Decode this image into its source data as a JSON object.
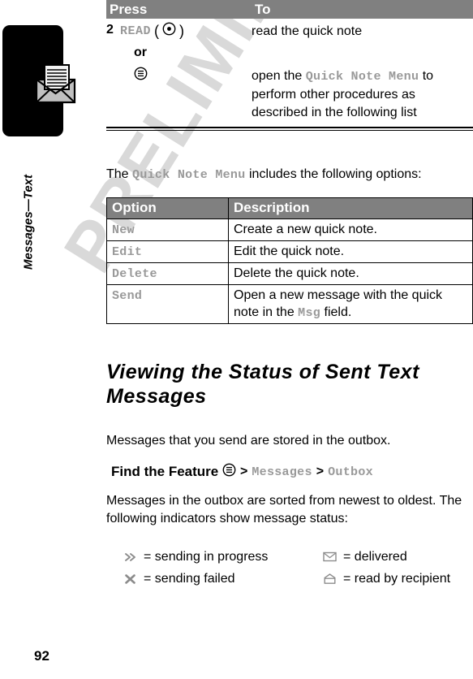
{
  "page": {
    "number": "92",
    "chapter_title": "Messages—Text",
    "watermark": "PRELIMINARY",
    "chapter_icon": "envelope-with-letter-icon"
  },
  "steps_table": {
    "headers": {
      "press": "Press",
      "to": "To"
    },
    "rows": [
      {
        "number": "2",
        "key_label": "READ",
        "key_icon": "center-select-key-icon",
        "description": "read the quick note"
      }
    ],
    "or_label": "or",
    "alt_row": {
      "key_icon": "menu-key-icon",
      "description_before": "open the ",
      "description_mono": "Quick Note Menu",
      "description_after": " to perform other procedures as described in the following list"
    }
  },
  "intro": {
    "before": "The ",
    "mono": "Quick Note Menu",
    "after": " includes the following options:"
  },
  "options_table": {
    "headers": {
      "option": "Option",
      "description": "Description"
    },
    "rows": [
      {
        "option": "New",
        "description": "Create a new quick note."
      },
      {
        "option": "Edit",
        "description": "Edit the quick note."
      },
      {
        "option": "Delete",
        "description": "Delete the quick note."
      },
      {
        "option": "Send",
        "description_before": "Open a new message with the quick note in the ",
        "description_mono": "Msg",
        "description_after": " field."
      }
    ]
  },
  "section": {
    "heading": "Viewing the Status of Sent Text Messages",
    "outbox_para": "Messages that you send are stored in the outbox.",
    "sorted_para": "Messages in the outbox are sorted from newest to oldest. The following indicators show message status:"
  },
  "find_feature": {
    "label": "Find the Feature",
    "menu_icon": "menu-key-icon",
    "separator": ">",
    "path": [
      "Messages",
      "Outbox"
    ]
  },
  "indicators": [
    {
      "icon": "double-chevron-icon",
      "glyph": "»",
      "label": "= sending in progress"
    },
    {
      "icon": "closed-envelope-icon",
      "glyph": "",
      "label": "= delivered"
    },
    {
      "icon": "x-mark-icon",
      "glyph": "✖",
      "label": "= sending failed"
    },
    {
      "icon": "open-envelope-icon",
      "glyph": "",
      "label": "= read by recipient"
    }
  ],
  "colors": {
    "table_header_bg": "#808080",
    "ui_mono_text": "#999999",
    "watermark": "#d9d9d9",
    "chapter_tab": "#000000"
  }
}
